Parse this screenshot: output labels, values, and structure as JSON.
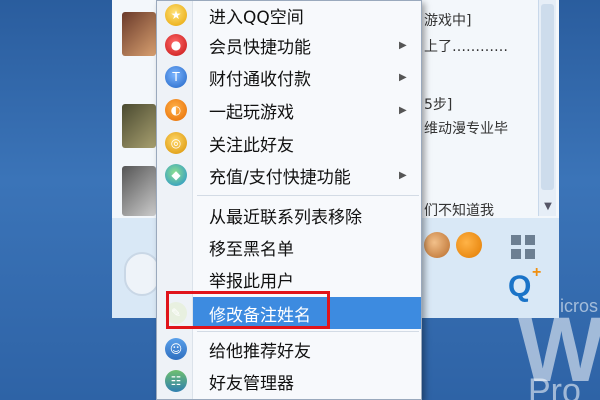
{
  "menu": {
    "items": [
      {
        "label": "进入QQ空间",
        "icon": "qzone-star-icon",
        "submenu": false
      },
      {
        "label": "会员快捷功能",
        "icon": "qq-penguin-icon",
        "submenu": true
      },
      {
        "label": "财付通收付款",
        "icon": "tenpay-shield-icon",
        "submenu": true
      },
      {
        "label": "一起玩游戏",
        "icon": "game-icon",
        "submenu": true
      },
      {
        "label": "关注此好友",
        "icon": "follow-icon",
        "submenu": false
      },
      {
        "label": "充值/支付快捷功能",
        "icon": "recharge-icon",
        "submenu": true
      },
      {
        "label": "从最近联系列表移除",
        "icon": "",
        "submenu": false
      },
      {
        "label": "移至黑名单",
        "icon": "",
        "submenu": false
      },
      {
        "label": "举报此用户",
        "icon": "",
        "submenu": false
      },
      {
        "label": "修改备注姓名",
        "icon": "edit-remark-icon",
        "submenu": false,
        "highlighted": true
      },
      {
        "label": "给他推荐好友",
        "icon": "recommend-friend-icon",
        "submenu": false
      },
      {
        "label": "好友管理器",
        "icon": "friend-manager-icon",
        "submenu": false
      }
    ],
    "submenu_arrow": "▶",
    "highlight_color": "#3d8be0",
    "annotation_color": "#e0141a"
  },
  "chat_snippets": {
    "line1": "游戏中]",
    "line2": "上了…………",
    "line3": "5步]",
    "line4": "维动漫专业毕",
    "line5": "们不知道我"
  },
  "wallpaper": {
    "big_letter": "W",
    "small_text": "icros",
    "bottom_text": "Pro"
  },
  "toolbar": {
    "q_logo": "Q",
    "q_plus": "+"
  }
}
